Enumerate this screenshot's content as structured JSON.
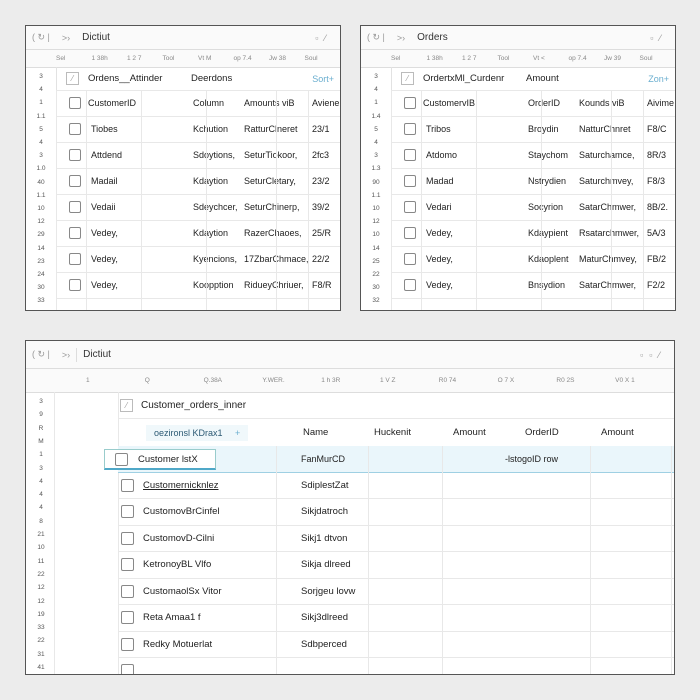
{
  "panels": [
    {
      "title": "Dictiut",
      "ruler": [
        "Sel",
        "1 38h",
        "1 2 7",
        "Tool",
        "Vt M",
        "op 7.4",
        "Jw 38",
        "Soul"
      ],
      "group": {
        "name": "Ordens__Attinder",
        "label": "Deerdons",
        "action": "Sort+"
      },
      "header": [
        "CustomerID",
        "Column",
        "Amounts viB",
        "Aviene"
      ],
      "rows": [
        [
          "Tiobes",
          "Kchution",
          "RatturClneret",
          "23/1"
        ],
        [
          "Attdend",
          "Sdoytions,",
          "SeturTiokoor,",
          "2fc3"
        ],
        [
          "Madail",
          "Kdaytion",
          "SeturCletary,",
          "23/2"
        ],
        [
          "Vedaii",
          "Sdeychcer,",
          "SeturChinerp,",
          "39/2"
        ],
        [
          "Vedey,",
          "Kdaytion",
          "RazerChaoes,",
          "25/R"
        ],
        [
          "Vedey,",
          "Kyencions,",
          "17ZbarChmace,",
          "22/2"
        ],
        [
          "Vedey,",
          "Koopption",
          "RidueyChriuer,",
          "F8/R"
        ]
      ],
      "gutter": [
        "3",
        "4",
        "1",
        "1.1",
        "5",
        "4",
        "3",
        "1.0",
        "40",
        "1.1",
        "10",
        "12",
        "29",
        "14",
        "23",
        "24",
        "30",
        "33"
      ]
    },
    {
      "title": "Orders",
      "ruler": [
        "Sel",
        "1 38h",
        "1 2 7",
        "Tool",
        "Vt <",
        "op 7.4",
        "Jw 39",
        "Soul"
      ],
      "group": {
        "name": "OrdertxMl_Curdenr",
        "label": "Amount",
        "action": "Zon+"
      },
      "header": [
        "CustomervIB",
        "OrderID",
        "Kounds viB",
        "Aivime"
      ],
      "rows": [
        [
          "Tribos",
          "Broydin",
          "NatturChnret",
          "F8/C"
        ],
        [
          "Atdomo",
          "Staychom",
          "Saturchamce,",
          "8R/3"
        ],
        [
          "Madad",
          "Nstrydien",
          "Saturchmvey,",
          "F8/3"
        ],
        [
          "Vedari",
          "Socyrion",
          "SatarChmwer,",
          "8B/2."
        ],
        [
          "Vedey,",
          "Kdaypient",
          "Rsatarchmwer,",
          "5A/3"
        ],
        [
          "Vedey,",
          "Kdaoplent",
          "MaturChmvey,",
          "FB/2"
        ],
        [
          "Vedey,",
          "Bnsydion",
          "SatarChmwer,",
          "F2/2"
        ]
      ],
      "gutter": [
        "3",
        "4",
        "1",
        "1.4",
        "5",
        "4",
        "3",
        "1.3",
        "90",
        "1.1",
        "10",
        "12",
        "10",
        "14",
        "25",
        "22",
        "30",
        "32"
      ]
    }
  ],
  "main": {
    "title": "Dictiut",
    "ruler": [
      "1",
      "Q",
      "Q.38A",
      "Y.WER.",
      "1 h 3R",
      "1 V Z",
      "R0 74",
      "O 7 X",
      "R0 2S",
      "V0 X 1"
    ],
    "group": "Customer_orders_inner",
    "header_pill": "oezironsl KDrax1",
    "header_add": "+",
    "columns": [
      "Name",
      "Huckenit",
      "Amount",
      "OrderID",
      "Amount"
    ],
    "selected_row": {
      "name": "Customer lstX",
      "value": "FanMurCD",
      "note": "-lstogoID row"
    },
    "rows": [
      [
        "Customernicknlez",
        "SdiplestZat"
      ],
      [
        "CustomovBrCinfel",
        "Sikjdatroch"
      ],
      [
        "CustomovD-Cilni",
        "Sikj1 dtvon"
      ],
      [
        "KetronoyBL Vlfo",
        "Sikja dlreed"
      ],
      [
        "CustomaolSx Vitor",
        "Sorjgeu lovw"
      ],
      [
        "Reta Amaa1 f",
        "Sikj3dlreed"
      ],
      [
        "Redky Motuerlat",
        "Sdbperced"
      ]
    ],
    "gutter": [
      "3",
      "9",
      "R",
      "M",
      "1",
      "3",
      "4",
      "4",
      "4",
      "8",
      "21",
      "10",
      "11",
      "22",
      "12",
      "12",
      "19",
      "33",
      "22",
      "31",
      "41"
    ]
  },
  "colors": {
    "highlight": "#eaf6fb",
    "selected_border": "#4fa8c8",
    "link": "#6aaecf"
  }
}
